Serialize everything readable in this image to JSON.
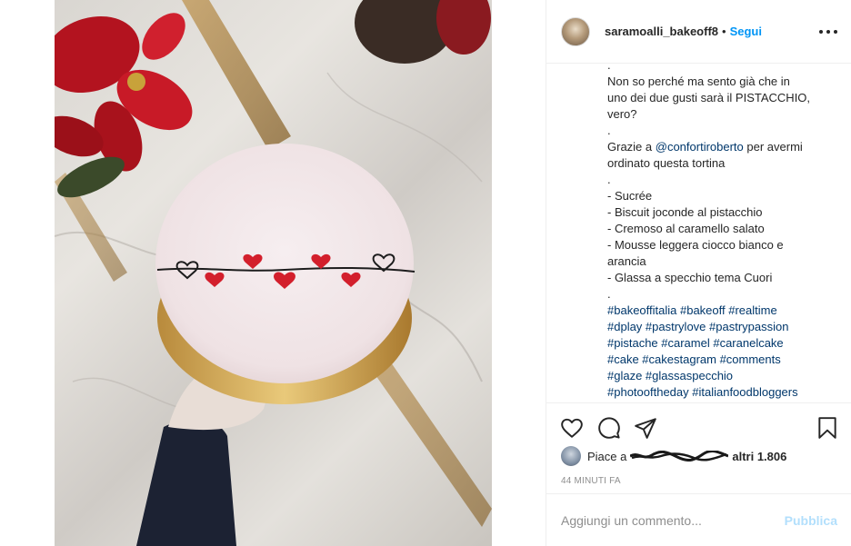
{
  "post": {
    "username": "saramoalli_bakeoff8",
    "separator": "•",
    "follow_label": "Segui",
    "more_icon": "more-options-icon"
  },
  "caption": {
    "lines": [
      ".",
      "Non so perché ma sento già che in",
      "uno dei due gusti sarà il PISTACCHIO,",
      "vero?",
      ".",
      "Grazie a ",
      "ordinato questa tortina",
      ".",
      "- Sucrée",
      "- Biscuit joconde al pistacchio",
      "- Cremoso al caramello salato",
      "- Mousse leggera ciocco bianco e",
      "arancia",
      "- Glassa a specchio tema Cuori",
      "."
    ],
    "mention": "@confortiroberto",
    "mention_suffix": " per avermi",
    "hashtag_lines": [
      "#bakeoffitalia #bakeoff #realtime",
      "#dplay #pastrylove #pastrypassion",
      "#pistache #caramel #caranelcake",
      "#cake #cakestagram #comments",
      "#glaze #glassaspecchio",
      "#photooftheday #italianfoodbloggers"
    ]
  },
  "actions": {
    "like_icon": "heart-icon",
    "comment_icon": "comment-icon",
    "share_icon": "share-icon",
    "save_icon": "bookmark-icon"
  },
  "likes": {
    "prefix": "Piace a",
    "suffix": "altri 1.806"
  },
  "timestamp": "44 MINUTI FA",
  "comment_box": {
    "placeholder": "Aggiungi un commento...",
    "publish_label": "Pubblica"
  },
  "colors": {
    "accent": "#0095f6",
    "link": "#00376b",
    "publish_disabled": "#b2dffc",
    "heart_red": "#d31f2c"
  }
}
